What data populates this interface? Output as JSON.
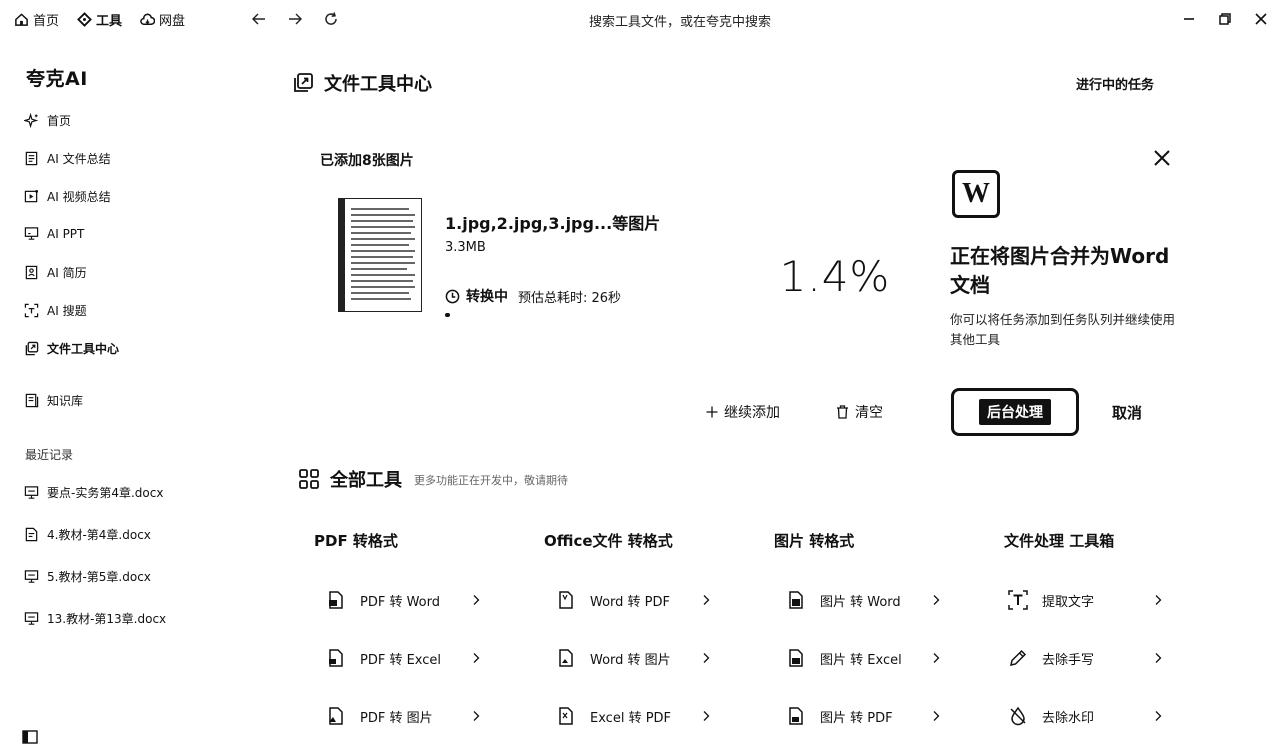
{
  "topbar": {
    "nav": [
      {
        "label": "首页",
        "icon": "home-icon"
      },
      {
        "label": "工具",
        "icon": "tools-icon"
      },
      {
        "label": "网盘",
        "icon": "cloud-icon"
      }
    ],
    "search_placeholder": "搜索工具文件，或在夸克中搜索"
  },
  "sidebar": {
    "brand": "夸克AI",
    "items": [
      {
        "label": "首页",
        "icon": "sparkle-icon"
      },
      {
        "label": "AI 文件总结",
        "icon": "doc-summary-icon"
      },
      {
        "label": "AI 视频总结",
        "icon": "video-summary-icon"
      },
      {
        "label": "AI PPT",
        "icon": "presentation-icon"
      },
      {
        "label": "AI 简历",
        "icon": "resume-icon"
      },
      {
        "label": "AI 搜题",
        "icon": "scan-question-icon"
      },
      {
        "label": "文件工具中心",
        "icon": "file-tools-icon"
      },
      {
        "label": "知识库",
        "icon": "knowledge-base-icon"
      }
    ],
    "recent_title": "最近记录",
    "recent": [
      {
        "label": "要点-实务第4章.docx"
      },
      {
        "label": "4.教材-第4章.docx"
      },
      {
        "label": "5.教材-第5章.docx"
      },
      {
        "label": "13.教材-第13章.docx"
      }
    ]
  },
  "main": {
    "title": "文件工具中心",
    "tasks_link": "进行中的任务",
    "upload": {
      "added_label": "已添加8张图片",
      "file_name": "1.jpg,2.jpg,3.jpg...等图片",
      "file_size": "3.3MB",
      "state": "转换中",
      "eta": "预估总耗时: 26秒",
      "progress_fraction": 0.014,
      "percent": "1.4%",
      "add_more": "继续添加",
      "clear": "清空"
    },
    "panel": {
      "logo_letter": "W",
      "title": "正在将图片合并为Word文档",
      "desc": "你可以将任务添加到任务队列并继续使用其他工具",
      "background_button": "后台处理",
      "cancel_button": "取消"
    },
    "tools": {
      "title": "全部工具",
      "subtitle": "更多功能正在开发中，敬请期待",
      "columns": [
        {
          "title": "PDF 转格式",
          "items": [
            {
              "label": "PDF 转 Word",
              "icon": "pdf-to-word-icon"
            },
            {
              "label": "PDF 转 Excel",
              "icon": "pdf-to-excel-icon"
            },
            {
              "label": "PDF 转 图片",
              "icon": "pdf-to-image-icon"
            }
          ]
        },
        {
          "title": "Office文件 转格式",
          "items": [
            {
              "label": "Word 转 PDF",
              "icon": "word-to-pdf-icon"
            },
            {
              "label": "Word 转 图片",
              "icon": "word-to-image-icon"
            },
            {
              "label": "Excel 转 PDF",
              "icon": "excel-to-pdf-icon"
            }
          ]
        },
        {
          "title": "图片 转格式",
          "items": [
            {
              "label": "图片 转 Word",
              "icon": "image-to-word-icon"
            },
            {
              "label": "图片 转 Excel",
              "icon": "image-to-excel-icon"
            },
            {
              "label": "图片 转 PDF",
              "icon": "image-to-pdf-icon"
            }
          ]
        },
        {
          "title": "文件处理 工具箱",
          "items": [
            {
              "label": "提取文字",
              "icon": "extract-text-icon"
            },
            {
              "label": "去除手写",
              "icon": "remove-handwriting-icon"
            },
            {
              "label": "去除水印",
              "icon": "remove-watermark-icon"
            }
          ]
        }
      ]
    }
  }
}
